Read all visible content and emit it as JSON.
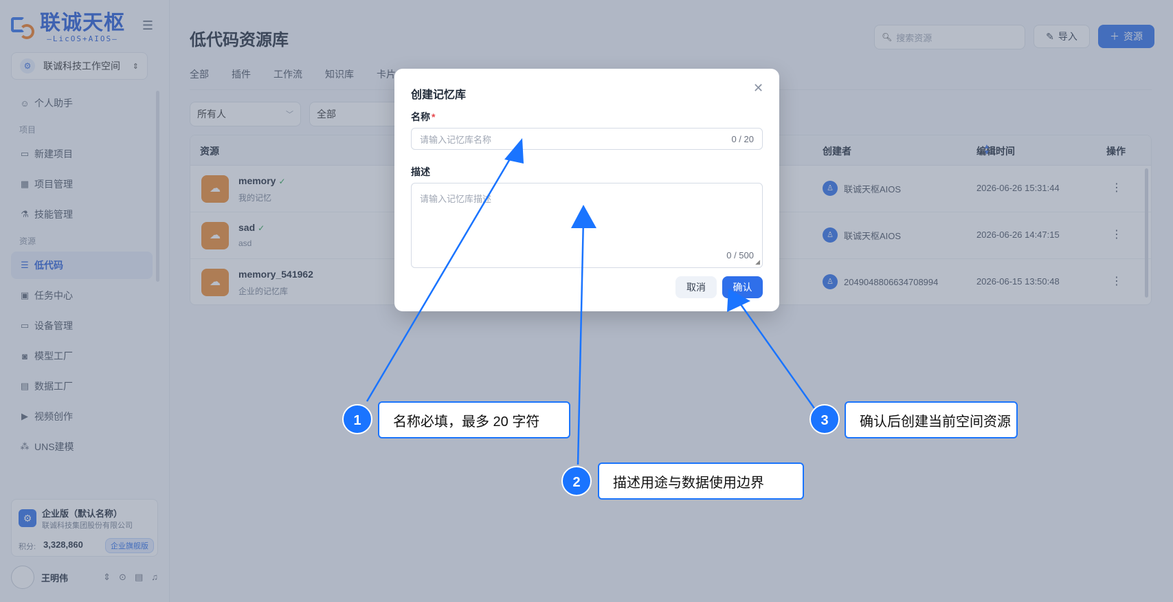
{
  "app": {
    "logo_title": "联诚天枢",
    "logo_sub": "—LicOS+AIOS—",
    "workspace": "联诚科技工作空间"
  },
  "sidebar": {
    "items": [
      {
        "label": "个人助手",
        "icon": "chat-bot-icon"
      },
      {
        "label": "新建项目",
        "icon": "monitor-icon"
      },
      {
        "label": "项目管理",
        "icon": "grid-icon"
      },
      {
        "label": "技能管理",
        "icon": "flask-icon"
      },
      {
        "label": "低代码",
        "icon": "list-icon"
      },
      {
        "label": "任务中心",
        "icon": "calendar-icon"
      },
      {
        "label": "设备管理",
        "icon": "laptop-icon"
      },
      {
        "label": "模型工厂",
        "icon": "robot-icon"
      },
      {
        "label": "数据工厂",
        "icon": "database-icon"
      },
      {
        "label": "视频创作",
        "icon": "video-icon"
      },
      {
        "label": "UNS建模",
        "icon": "network-icon"
      }
    ],
    "section_project": "项目",
    "section_resource": "资源"
  },
  "enterprise": {
    "name": "企业版（默认名称）",
    "org": "联诚科技集团股份有限公司",
    "points_label": "积分:",
    "points": "3,328,860",
    "badge": "企业旗舰版"
  },
  "user": {
    "name": "王明伟"
  },
  "main": {
    "title": "低代码资源库",
    "search_placeholder": "搜索资源",
    "import_label": "导入",
    "add_label": "资源",
    "tabs": [
      "全部",
      "插件",
      "工作流",
      "知识库",
      "卡片"
    ],
    "filter_owner": "所有人",
    "filter_type": "全部"
  },
  "table": {
    "headers": {
      "resource": "资源",
      "creator": "创建者",
      "edit_time": "编辑时间",
      "ops": "操作"
    },
    "rows": [
      {
        "name": "memory",
        "desc": "我的记忆",
        "creator": "联诚天枢AIOS",
        "time": "2026-06-26 15:31:44",
        "verified": true
      },
      {
        "name": "sad",
        "desc": "asd",
        "creator": "联诚天枢AIOS",
        "time": "2026-06-26 14:47:15",
        "verified": true
      },
      {
        "name": "memory_541962",
        "desc": "企业的记忆库",
        "creator": "2049048806634708994",
        "time": "2026-06-15 13:50:48",
        "verified": false
      }
    ]
  },
  "modal": {
    "title": "创建记忆库",
    "name_label": "名称",
    "name_placeholder": "请输入记忆库名称",
    "name_count": "0 / 20",
    "desc_label": "描述",
    "desc_placeholder": "请输入记忆库描述",
    "desc_count": "0 / 500",
    "cancel": "取消",
    "confirm": "确认"
  },
  "annotations": [
    {
      "num": "1",
      "text": "名称必填，最多 20 字符"
    },
    {
      "num": "2",
      "text": "描述用途与数据使用边界"
    },
    {
      "num": "3",
      "text": "确认后创建当前空间资源"
    }
  ],
  "colors": {
    "accent": "#2f6fea",
    "annotation": "#1a74ff",
    "resource_icon": "#ef8a2e"
  }
}
